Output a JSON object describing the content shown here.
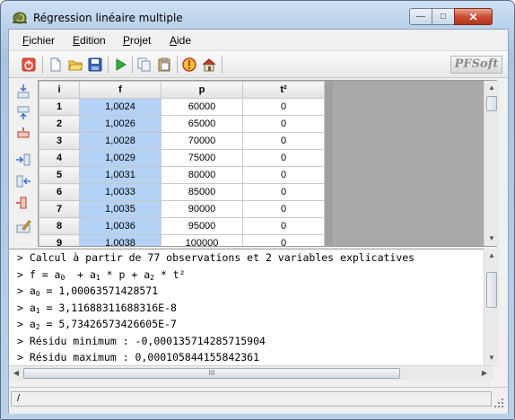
{
  "window": {
    "title": "Régression linéaire multiple",
    "minimize_glyph": "—",
    "maximize_glyph": "□",
    "close_glyph": "✕"
  },
  "menu": {
    "items": [
      {
        "label": "Fichier",
        "accel": "F",
        "rest": "ichier"
      },
      {
        "label": "Edition",
        "accel": "E",
        "rest": "dition"
      },
      {
        "label": "Projet",
        "accel": "P",
        "rest": "rojet"
      },
      {
        "label": "Aide",
        "accel": "A",
        "rest": "ide"
      }
    ]
  },
  "toolbar": {
    "icons": [
      "power-icon",
      "new-file-icon",
      "open-folder-icon",
      "save-icon",
      "run-icon",
      "copy-icon",
      "paste-icon",
      "warning-icon",
      "home-icon"
    ],
    "brand": "PFSoft"
  },
  "grid": {
    "headers": [
      "i",
      "f",
      "p",
      "t²"
    ],
    "rows": [
      [
        "1",
        "1,0024",
        "60000",
        "0"
      ],
      [
        "2",
        "1,0026",
        "65000",
        "0"
      ],
      [
        "3",
        "1,0028",
        "70000",
        "0"
      ],
      [
        "4",
        "1,0029",
        "75000",
        "0"
      ],
      [
        "5",
        "1,0031",
        "80000",
        "0"
      ],
      [
        "6",
        "1,0033",
        "85000",
        "0"
      ],
      [
        "7",
        "1,0035",
        "90000",
        "0"
      ],
      [
        "8",
        "1,0036",
        "95000",
        "0"
      ],
      [
        "9",
        "1,0038",
        "100000",
        "0"
      ]
    ]
  },
  "output": {
    "lines": [
      "> Calcul à partir de 77 observations et 2 variables explicatives",
      "> f = a0  + a1 * p + a2 * t²",
      "> a0 = 1,00063571428571",
      "> a1 = 3,11688311688316E-8",
      "> a2 = 5,73426573426605E-7",
      "> Résidu minimum : -0,000135714285715904",
      "> Résidu maximum : 0,000105844155842361"
    ]
  },
  "scroll": {
    "h_thumb_grip": "III"
  },
  "status": {
    "text": "/"
  },
  "colors": {
    "selection": "#b4d2f5",
    "grid_background": "#a9a9a9",
    "close_button": "#c75035"
  }
}
